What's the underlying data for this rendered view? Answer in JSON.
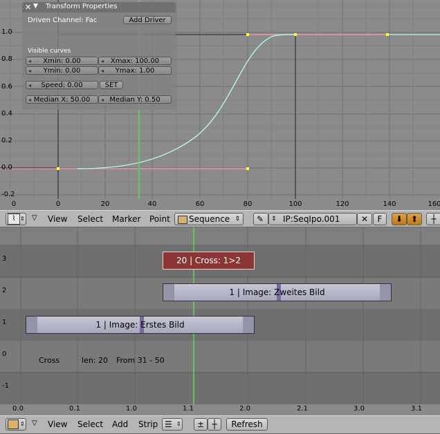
{
  "ipo": {
    "y_ticks": [
      "1.0",
      "0.8",
      "0.6",
      "0.4",
      "0.2",
      "0.0",
      "-0.2"
    ],
    "x_ticks": [
      "0",
      "20",
      "40",
      "60",
      "80",
      "100",
      "120",
      "140",
      "160"
    ],
    "panel": {
      "title": "Transform Properties",
      "driven_channel": "Driven Channel: Fac",
      "add_driver": "Add Driver",
      "visible_curves": "Visible curves",
      "xmin": "Xmin: 0.00",
      "xmax": "Xmax: 100.00",
      "ymin": "Ymin: 0.00",
      "ymax": "Ymax: 1.00",
      "speed": "Speed: 0.00",
      "set": "SET",
      "median_x": "Median X: 50.00",
      "median_y": "Median Y: 0.50"
    },
    "curve_color": "#b5f5f0",
    "extend_color": "#ff9aa8"
  },
  "ipo_header": {
    "view": "View",
    "select": "Select",
    "marker": "Marker",
    "point": "Point",
    "block_type": "Sequence",
    "ipo_name": "IP:SeqIpo.001",
    "f_label": "F"
  },
  "seq": {
    "y_ticks": [
      "3",
      "2",
      "1",
      "0",
      "-1"
    ],
    "x_ticks": [
      "0.0",
      "0.1",
      "1.0",
      "1.1",
      "2.0",
      "2.1",
      "3.0",
      "3.1"
    ],
    "strips": {
      "cross": "20 | Cross: 1>2",
      "image2": "1 | Image: Zweites Bild",
      "image1": "1 | Image: Erstes Bild"
    },
    "info": {
      "name": "Cross",
      "len": "len: 20",
      "from": "From 31 - 50"
    },
    "cross_color": "#8b3535"
  },
  "seq_header": {
    "view": "View",
    "select": "Select",
    "add": "Add",
    "strip": "Strip",
    "refresh": "Refresh"
  }
}
